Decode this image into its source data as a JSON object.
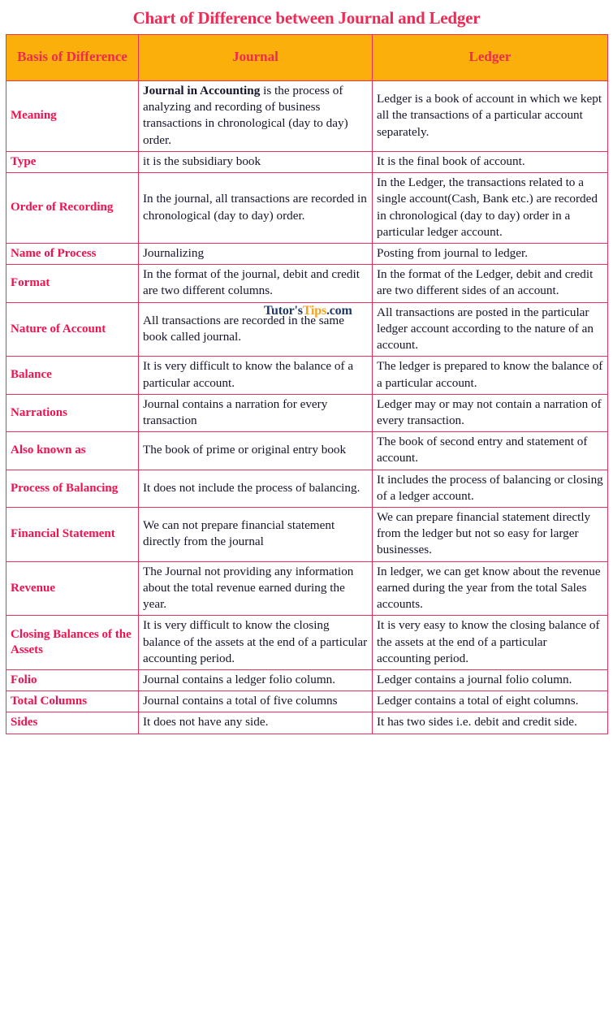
{
  "title": "Chart of Difference between Journal and Ledger",
  "colors": {
    "header_bg": "#fbaf0b",
    "header_text": "#ee2a55",
    "border": "#e8325c",
    "basis_text": "#f0114e",
    "body_text": "#14142b",
    "title_text": "#ef2a55",
    "watermark_dark": "#1f3864",
    "watermark_accent": "#f6a11a"
  },
  "table": {
    "headers": [
      "Basis of Difference",
      "Journal",
      "Ledger"
    ],
    "rows": [
      {
        "basis": "Meaning",
        "journal_prefix": "Journal in Accounting",
        "journal": " is the process of analyzing and recording of business transactions in chronological (day to day) order.",
        "ledger": "Ledger is a book of account in which we kept all the transactions of a particular account separately."
      },
      {
        "basis": "Type",
        "journal": "it is the subsidiary book",
        "ledger": "It is the final book of account."
      },
      {
        "basis": "Order of Recording",
        "journal": "In the journal, all transactions are recorded in chronological (day to day) order.",
        "ledger": "In the Ledger, the transactions related to a single account(Cash, Bank etc.) are recorded in chronological (day to day) order in a particular ledger account."
      },
      {
        "basis": "Name of Process",
        "journal": "Journalizing",
        "ledger": "Posting from journal to ledger."
      },
      {
        "basis": "Format",
        "journal": "In the format of the journal, debit and credit are two different columns.",
        "ledger": "In the format of the Ledger, debit and credit are two different sides of an account."
      },
      {
        "basis": "Nature of Account",
        "journal": "All transactions are recorded in the same book called journal.",
        "ledger": "All transactions are posted in the particular ledger account according to the nature of an account."
      },
      {
        "basis": "Balance",
        "journal": "It is very difficult to know the balance of a particular account.",
        "ledger": "The ledger is prepared to know the balance of a particular account."
      },
      {
        "basis": "Narrations",
        "journal": "Journal contains a narration for every transaction",
        "ledger": "Ledger may or may not contain a narration of every transaction."
      },
      {
        "basis": "Also known as",
        "journal": "The book of prime or original entry book",
        "ledger": "The book of second entry and statement of account."
      },
      {
        "basis": "Process of Balancing",
        "journal": "It does not include the process of balancing.",
        "ledger": "It includes the process of balancing or closing of a ledger account."
      },
      {
        "basis": "Financial Statement",
        "journal": "We can not prepare financial statement directly from the journal",
        "ledger": "We can prepare financial statement directly from the ledger but not so easy for larger businesses."
      },
      {
        "basis": "Revenue",
        "journal": "The Journal not providing any information about the total revenue earned during the year.",
        "ledger": "In ledger, we can get know about the revenue earned during the year from the total Sales accounts."
      },
      {
        "basis": "Closing Balances of the Assets",
        "journal": "It is very difficult to know the closing balance of the assets at the end of a particular accounting period.",
        "ledger": "It is very easy to know the closing balance of the assets at the end of a particular accounting period."
      },
      {
        "basis": "Folio",
        "journal": "Journal contains a ledger folio column.",
        "ledger": "Ledger contains a journal folio column."
      },
      {
        "basis": "Total Columns",
        "journal": "Journal contains a total of five columns",
        "ledger": "Ledger contains a total of eight columns."
      },
      {
        "basis": "Sides",
        "journal": "It does not have any side.",
        "ledger": "It has two sides i.e. debit and credit side."
      }
    ]
  },
  "watermark": {
    "part1": "Tutor's",
    "part2": "Tips",
    "part3": ".com"
  }
}
